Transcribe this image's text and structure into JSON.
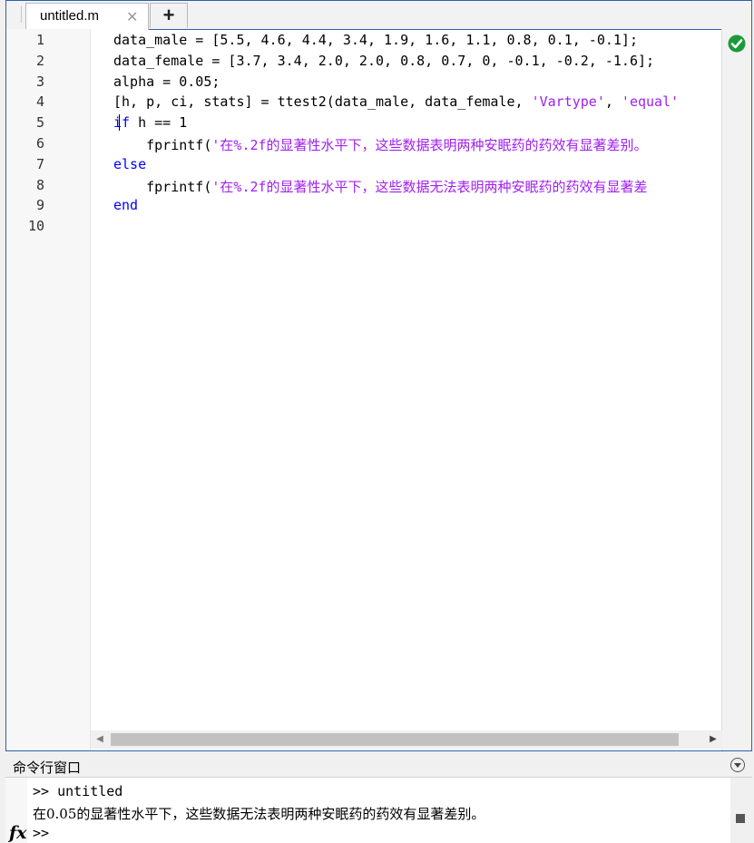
{
  "editor": {
    "tab_label": "untitled.m",
    "tab_close_glyph": "✕",
    "add_tab_glyph": "+",
    "line_numbers": [
      "1",
      "2",
      "3",
      "4",
      "5",
      "6",
      "7",
      "8",
      "9",
      "10"
    ],
    "code": {
      "l1": "data_male = [5.5, 4.6, 4.4, 3.4, 1.9, 1.6, 1.1, 0.8, 0.1, -0.1];",
      "l2": "data_female = [3.7, 3.4, 2.0, 2.0, 0.8, 0.7, 0, -0.1, -0.2, -1.6];",
      "l3": "alpha = 0.05;",
      "l4_a": "[h, p, ci, stats] = ttest2(data_male, data_female, ",
      "l4_s1": "'Vartype'",
      "l4_b": ", ",
      "l4_s2": "'equal'",
      "l5_kw": "if",
      "l5_rest": " h == 1",
      "l6_a": "    fprintf(",
      "l6_s1": "'",
      "l6_s2": "在",
      "l6_s3": "%.2f",
      "l6_s4": "的显著性水平下，这些数据表明两种安眠药的药效有显著差别。",
      "l7_kw": "else",
      "l8_a": "    fprintf(",
      "l8_s1": "'",
      "l8_s2": "在",
      "l8_s3": "%.2f",
      "l8_s4": "的显著性水平下，这些数据无法表明两种安眠药的药效有显著差",
      "l9_kw": "end"
    },
    "status_icon": "check-circle-icon"
  },
  "command_window": {
    "title": "命令行窗口",
    "lines": [
      ">> untitled",
      "在0.05的显著性水平下，这些数据无法表明两种安眠药的药效有显著差别。",
      ">>"
    ],
    "fx_label": "fx"
  },
  "colors": {
    "keyword": "#0000ff",
    "string": "#a020f0",
    "accent": "#2a64ad",
    "ok": "#1a9a3a"
  }
}
